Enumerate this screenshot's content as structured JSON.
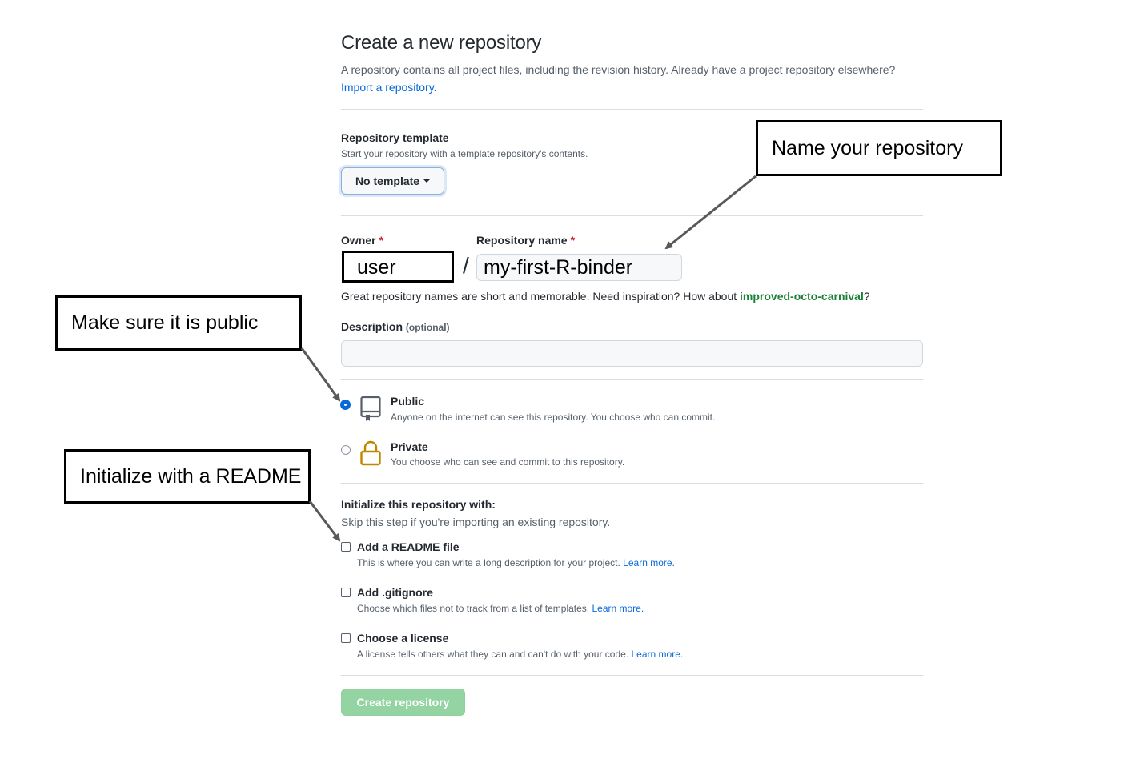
{
  "page": {
    "title": "Create a new repository",
    "intro_text": "A repository contains all project files, including the revision history. Already have a project repository elsewhere?",
    "import_link": "Import a repository."
  },
  "template": {
    "label": "Repository template",
    "note": "Start your repository with a template repository's contents.",
    "button_label": "No template"
  },
  "owner": {
    "label": "Owner",
    "required_mark": "*",
    "value": "user"
  },
  "separator": "/",
  "repo_name": {
    "label": "Repository name",
    "required_mark": "*",
    "value": "my-first-R-binder"
  },
  "hint": {
    "text": "Great repository names are short and memorable. Need inspiration? How about",
    "suggestion": "improved-octo-carnival",
    "suffix": "?"
  },
  "description": {
    "label": "Description",
    "optional": "(optional)",
    "value": ""
  },
  "visibility": {
    "public": {
      "title": "Public",
      "desc": "Anyone on the internet can see this repository. You choose who can commit.",
      "selected": true
    },
    "private": {
      "title": "Private",
      "desc": "You choose who can see and commit to this repository.",
      "selected": false
    }
  },
  "init": {
    "title": "Initialize this repository with:",
    "note": "Skip this step if you're importing an existing repository.",
    "readme": {
      "title": "Add a README file",
      "desc": "This is where you can write a long description for your project.",
      "link": "Learn more.",
      "checked": false
    },
    "gitignore": {
      "title": "Add .gitignore",
      "desc": "Choose which files not to track from a list of templates.",
      "link": "Learn more.",
      "checked": false
    },
    "license": {
      "title": "Choose a license",
      "desc": "A license tells others what they can and can't do with your code.",
      "link": "Learn more.",
      "checked": false
    }
  },
  "create_button": "Create repository",
  "callouts": {
    "name": "Name your repository",
    "public": "Make sure it is public",
    "readme": "Initialize with a README"
  },
  "colors": {
    "link": "#0969da",
    "suggestion": "#1a7f37",
    "required": "#cf222e",
    "create_button": "#94d3a2",
    "lock_icon": "#bf8700"
  },
  "icons": {
    "public": "repo-icon",
    "private": "lock-icon"
  }
}
